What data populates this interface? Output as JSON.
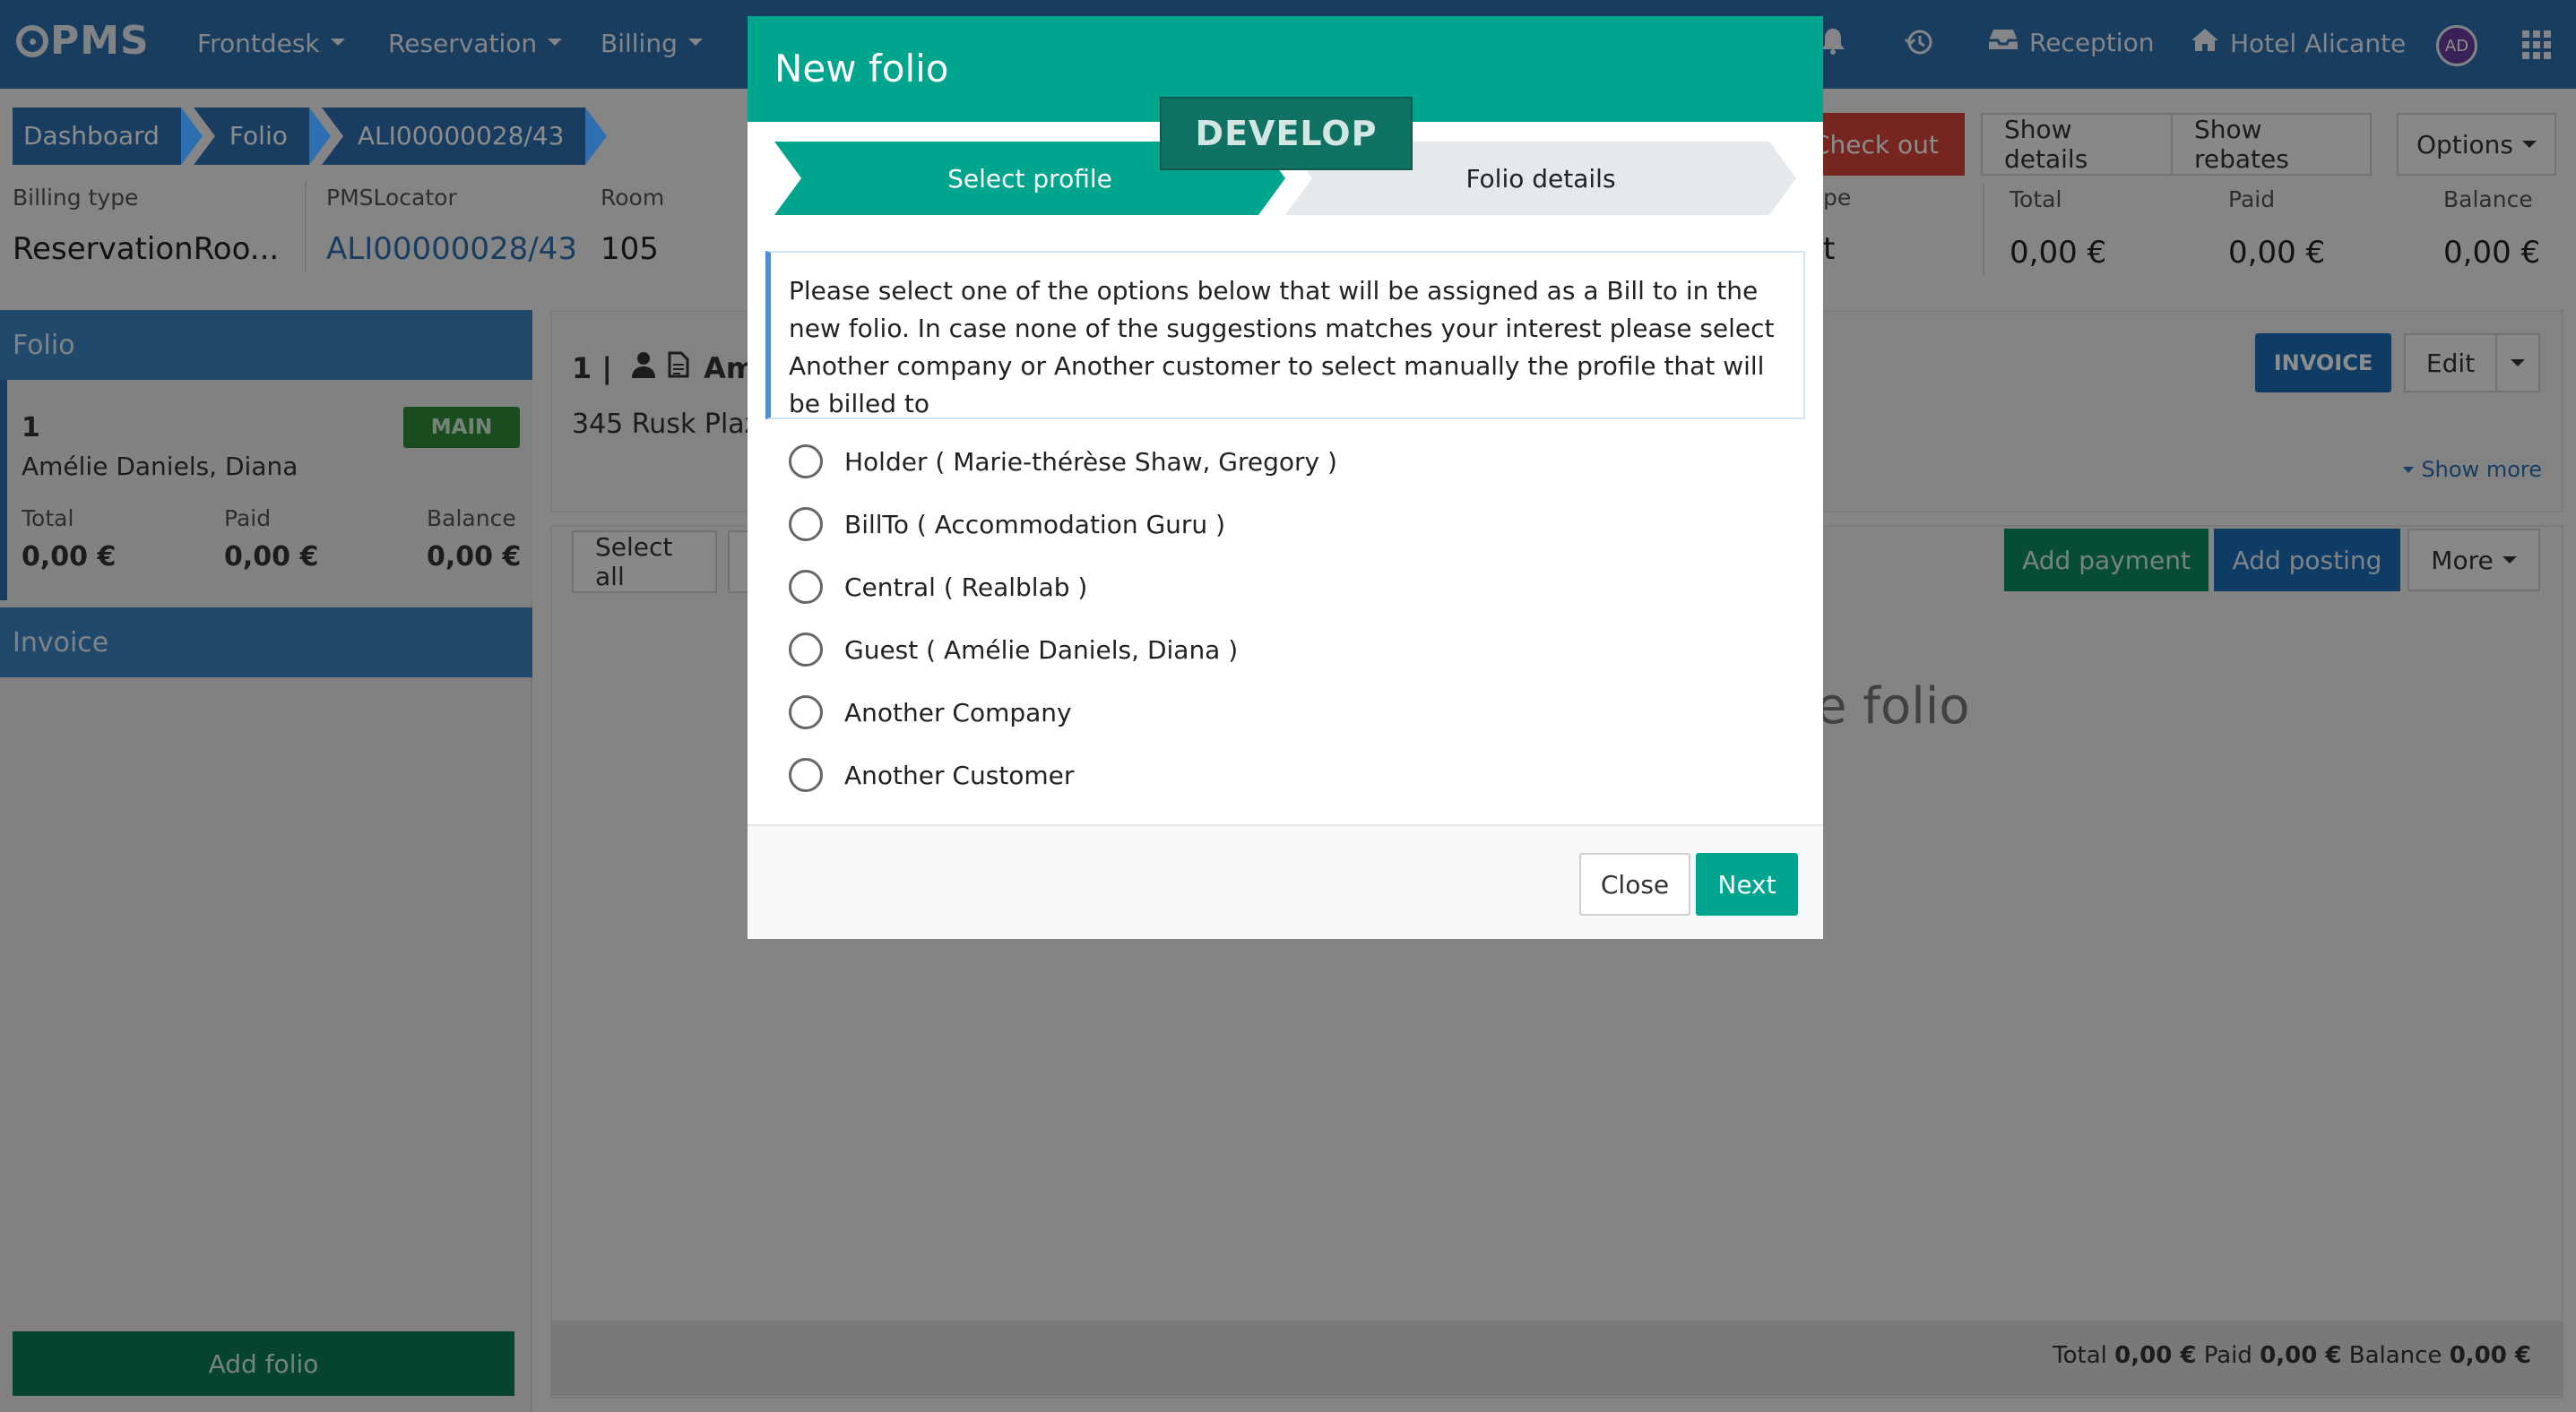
{
  "navbar": {
    "logo": "PMS",
    "menu": [
      {
        "label": "Frontdesk"
      },
      {
        "label": "Reservation"
      },
      {
        "label": "Billing"
      }
    ],
    "reception": "Reception",
    "hotel": "Hotel Alicante",
    "avatar": "AD"
  },
  "breadcrumb": [
    "Dashboard",
    "Folio",
    "ALI00000028/43"
  ],
  "header_actions": {
    "check_out": "Check out",
    "show_details": "Show details",
    "show_rebates": "Show rebates",
    "options": "Options"
  },
  "header_info": {
    "billing_type_label": "Billing type",
    "billing_type_value": "ReservationRoo...",
    "pms_locator_label": "PMSLocator",
    "pms_locator_value": "ALI00000028/43",
    "room_label": "Room",
    "room_value": "105",
    "type_label_partial": "pe",
    "type_value_partial": "t",
    "total_label": "Total",
    "total_value": "0,00 €",
    "paid_label": "Paid",
    "paid_value": "0,00 €",
    "balance_label": "Balance",
    "balance_value": "0,00 €"
  },
  "sidebar": {
    "folio_heading": "Folio",
    "folio_card": {
      "number": "1",
      "name": "Amélie Daniels, Diana",
      "badge": "MAIN",
      "total_label": "Total",
      "total_value": "0,00 €",
      "paid_label": "Paid",
      "paid_value": "0,00 €",
      "balance_label": "Balance",
      "balance_value": "0,00 €"
    },
    "invoice_heading": "Invoice",
    "add_folio": "Add folio"
  },
  "main": {
    "folio_title_prefix": "1 |",
    "folio_title_partial": "Am",
    "address_partial": "345 Rusk Plaz",
    "invoice_button": "INVOICE",
    "edit_button": "Edit",
    "show_more": "Show more",
    "select_all": "Select all",
    "add_payment": "Add payment",
    "add_posting": "Add posting",
    "more": "More",
    "empty_text_partial": "e folio",
    "footer": {
      "total_label": "Total",
      "total_value": "0,00 €",
      "paid_label": "Paid",
      "paid_value": "0,00 €",
      "balance_label": "Balance",
      "balance_value": "0,00 €"
    }
  },
  "modal": {
    "title": "New folio",
    "ribbon": "DEVELOP",
    "steps": [
      {
        "label": "Select profile",
        "active": true
      },
      {
        "label": "Folio details",
        "active": false
      }
    ],
    "notice": "Please select one of the options below that will be assigned as a Bill to in the new folio. In case none of the suggestions matches your interest please select Another company or Another customer to select manually the profile that will be billed to",
    "options": [
      "Holder ( Marie-thérèse Shaw, Gregory )",
      "BillTo ( Accommodation Guru )",
      "Central ( Realblab )",
      "Guest ( Amélie Daniels, Diana )",
      "Another Company",
      "Another Customer"
    ],
    "close_button": "Close",
    "next_button": "Next"
  },
  "colors": {
    "navbar": "#2c6fad",
    "modal_header": "#00a58d",
    "check_out": "#d9443a",
    "main_badge": "#2f8c3a",
    "invoice_button": "#1a6eb8"
  }
}
